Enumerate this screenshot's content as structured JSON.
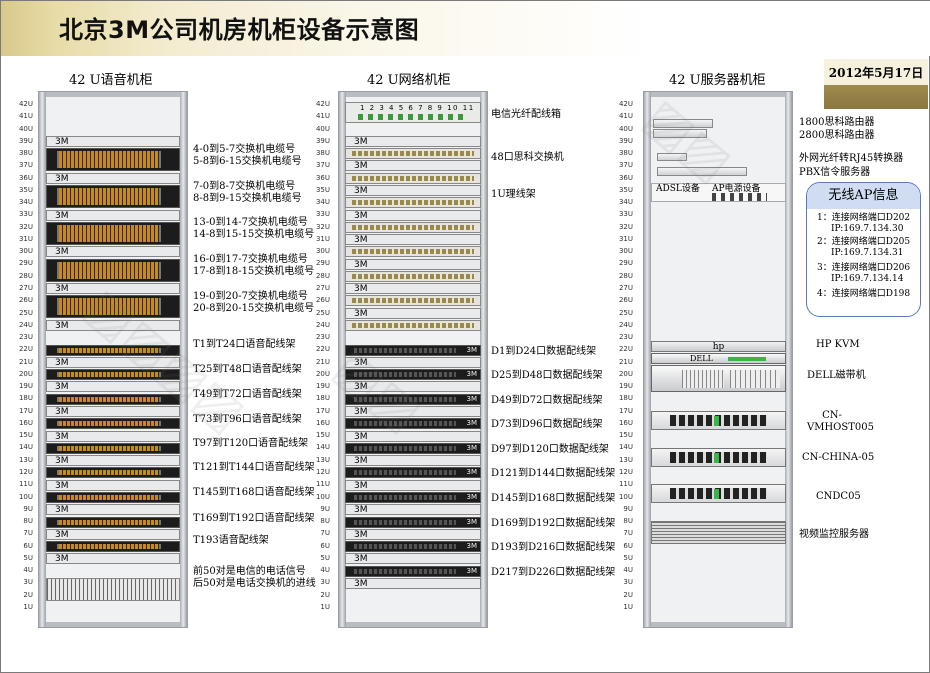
{
  "title": "北京3M公司机房机柜设备示意图",
  "date": "2012年5月17日",
  "racks": [
    {
      "title": "42 U语音机柜"
    },
    {
      "title": "42 U网络机柜"
    },
    {
      "title": "42 U服务器机柜"
    }
  ],
  "u_labels": [
    "42U",
    "41U",
    "40U",
    "39U",
    "38U",
    "37U",
    "36U",
    "35U",
    "34U",
    "33U",
    "32U",
    "31U",
    "30U",
    "29U",
    "28U",
    "27U",
    "26U",
    "25U",
    "24U",
    "23U",
    "22U",
    "21U",
    "20U",
    "19U",
    "18U",
    "17U",
    "16U",
    "15U",
    "14U",
    "13U",
    "12U",
    "11U",
    "10U",
    "9U",
    "8U",
    "7U",
    "6U",
    "5U",
    "4U",
    "3U",
    "2U",
    "1U"
  ],
  "brand": "3M",
  "fibre_numbers": "1 2 3 4 5 6 7 8 9 10 11 12",
  "voice_labels": [
    [
      "4-0到5-7交换机电缆号",
      "5-8到6-15交换机电缆号"
    ],
    [
      "7-0到8-7交换机电缆号",
      "8-8到9-15交换机电缆号"
    ],
    [
      "13-0到14-7交换机电缆号",
      "14-8到15-15交换机电缆号"
    ],
    [
      "16-0到17-7交换机电缆号",
      "17-8到18-15交换机电缆号"
    ],
    [
      "19-0到20-7交换机电缆号",
      "20-8到20-15交换机电缆号"
    ],
    [
      "T1到T24口语音配线架"
    ],
    [
      "T25到T48口语音配线架"
    ],
    [
      "T49到T72口语音配线架"
    ],
    [
      "T73到T96口语音配线架"
    ],
    [
      "T97到T120口语音配线架"
    ],
    [
      "T121到T144口语音配线架"
    ],
    [
      "T145到T168口语音配线架"
    ],
    [
      "T169到T192口语音配线架"
    ],
    [
      "T193语音配线架"
    ],
    [
      "前50对是电信的电话信号",
      "后50对是电话交换机的进线"
    ]
  ],
  "network_labels": {
    "fibre": "电信光纤配线箱",
    "switch48": "48口思科交换机",
    "cable_mgmt": "1U理线架",
    "patch": [
      "D1到D24口数据配线架",
      "D25到D48口数据配线架",
      "D49到D72口数据配线架",
      "D73到D96口数据配线架",
      "D97到D120口数据配线架",
      "D121到D144口数据配线架",
      "D145到D168口数据配线架",
      "D169到D192口数据配线架",
      "D193到D216口数据配线架",
      "D217到D226口数据配线架"
    ]
  },
  "server_labels": {
    "r1800": "1800思科路由器",
    "r2800": "2800思科路由器",
    "fibre_conv": "外网光纤转RJ45转换器",
    "pbx": "PBX信令服务器",
    "adsl": "ADSL设备",
    "ap_power": "AP电源设备",
    "hp_brand": "hp",
    "hp_kvm": "HP KVM",
    "dell_brand": "DELL",
    "dell_tape": "DELL磁带机",
    "s1": "CN-VMHOST005",
    "s2": "CN-CHINA-05",
    "s3": "CNDC05",
    "video": "视频监控服务器"
  },
  "ap_info": {
    "title": "无线AP信息",
    "items": [
      {
        "line1": "1：连接网络端口D202",
        "line2": "IP:169.7.134.30"
      },
      {
        "line1": "2：连接网络端口D205",
        "line2": "IP:169.7.134.31"
      },
      {
        "line1": "3：连接网络端口D206",
        "line2": "IP:169.7.134.14"
      },
      {
        "line1": "4：连接网络端口D198",
        "line2": ""
      }
    ]
  },
  "colors": {
    "title_band": "#d8c98b",
    "date_band": "#a8924e",
    "ap_border": "#5b7bb8",
    "port_orange": "#c88a1c"
  }
}
